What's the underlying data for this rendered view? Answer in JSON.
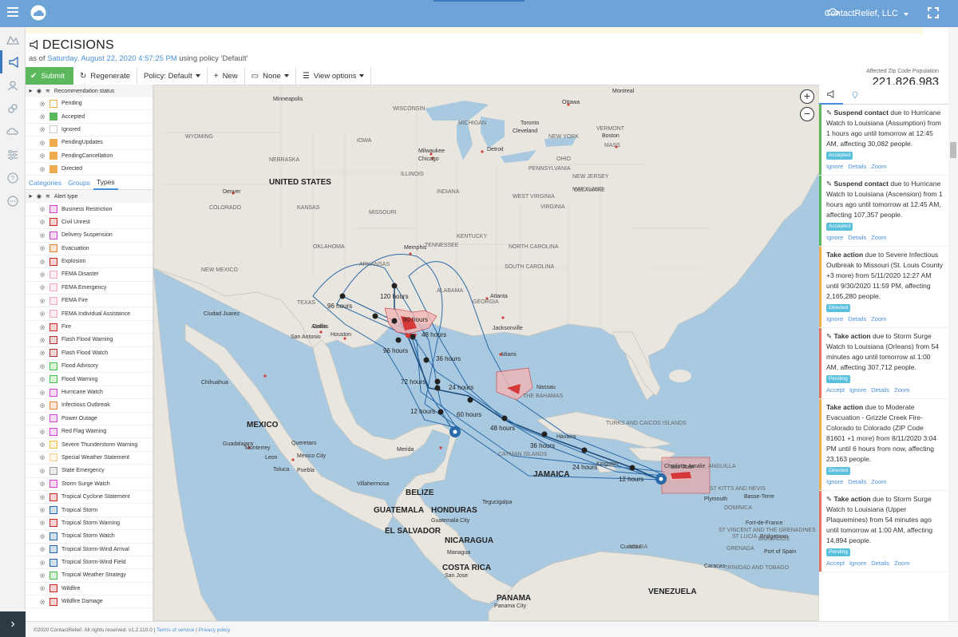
{
  "topbar": {
    "org": "ContactRelief, LLC"
  },
  "header": {
    "title": "DECISIONS",
    "as_of_prefix": "as of",
    "as_of_date": "Saturday, August 22, 2020 4:57:25 PM",
    "as_of_suffix": "using policy 'Default'",
    "affected_label": "Affected Zip Code Population",
    "affected_value": "221,826,983"
  },
  "toolbar": {
    "submit": "Submit",
    "regenerate": "Regenerate",
    "policy": "Policy: Default",
    "new": "New",
    "none": "None",
    "view_options": "View options"
  },
  "sidebar": {
    "rec_header": "Recommendation status",
    "statuses": [
      {
        "label": "Pending",
        "color": "#f0ad4e"
      },
      {
        "label": "Accepted",
        "color": "#5cb85c"
      },
      {
        "label": "Ignored",
        "color": "#cccccc"
      },
      {
        "label": "PendingUpdates",
        "color": "#f0ad4e"
      },
      {
        "label": "PendingCancellation",
        "color": "#f0ad4e"
      },
      {
        "label": "Directed",
        "color": "#f0ad4e"
      }
    ],
    "tabs": [
      "Categories",
      "Groups",
      "Types"
    ],
    "alert_header": "Alert type",
    "alert_types": [
      {
        "label": "Business Restriction",
        "color": "#cc44cc"
      },
      {
        "label": "Civil Unrest",
        "color": "#cc2222"
      },
      {
        "label": "Delivery Suspension",
        "color": "#cc44cc"
      },
      {
        "label": "Evacuation",
        "color": "#e08030"
      },
      {
        "label": "Explosion",
        "color": "#cc2222"
      },
      {
        "label": "FEMA Disaster",
        "color": "#f4a6c0"
      },
      {
        "label": "FEMA Emergency",
        "color": "#f4a6c0"
      },
      {
        "label": "FEMA Fire",
        "color": "#f4a6c0"
      },
      {
        "label": "FEMA Individual Assistance",
        "color": "#f4a6c0"
      },
      {
        "label": "Fire",
        "color": "#cc2222"
      },
      {
        "label": "Flash Flood Warning",
        "color": "#aa3333"
      },
      {
        "label": "Flash Flood Watch",
        "color": "#aa3333"
      },
      {
        "label": "Flood Advisory",
        "color": "#44bb44"
      },
      {
        "label": "Flood Warning",
        "color": "#44bb44"
      },
      {
        "label": "Hurricane Watch",
        "color": "#cc44cc"
      },
      {
        "label": "Infectious Outbreak",
        "color": "#e08030"
      },
      {
        "label": "Power Outage",
        "color": "#cc44cc"
      },
      {
        "label": "Red Flag Warning",
        "color": "#cc44cc"
      },
      {
        "label": "Severe Thunderstorm Warning",
        "color": "#f0c040"
      },
      {
        "label": "Special Weather Statement",
        "color": "#f4d090"
      },
      {
        "label": "State Emergency",
        "color": "#999999"
      },
      {
        "label": "Storm Surge Watch",
        "color": "#cc44cc"
      },
      {
        "label": "Tropical Cyclone Statement",
        "color": "#cc2222"
      },
      {
        "label": "Tropical Storm",
        "color": "#2266aa"
      },
      {
        "label": "Tropical Storm Warning",
        "color": "#cc2222"
      },
      {
        "label": "Tropical Storm Watch",
        "color": "#2266aa"
      },
      {
        "label": "Tropical Storm-Wind Arrival",
        "color": "#2266aa"
      },
      {
        "label": "Tropical Storm-Wind Field",
        "color": "#2266aa"
      },
      {
        "label": "Tropical Weather Strategy",
        "color": "#44bb44"
      },
      {
        "label": "Wildfire",
        "color": "#cc2222"
      },
      {
        "label": "Wildfire Damage",
        "color": "#cc2222"
      }
    ]
  },
  "map": {
    "countries": [
      "UNITED STATES",
      "MEXICO",
      "BELIZE",
      "GUATEMALA",
      "HONDURAS",
      "EL SALVADOR",
      "NICARAGUA",
      "COSTA RICA",
      "PANAMA",
      "VENEZUELA",
      "JAMAICA"
    ],
    "states": [
      "WISCONSIN",
      "MICHIGAN",
      "IOWA",
      "NEBRASKA",
      "ILLINOIS",
      "INDIANA",
      "OHIO",
      "PENNSYLVANIA",
      "NEW YORK",
      "VERMONT",
      "MASS",
      "NEW JERSEY",
      "MARYLAND",
      "WEST VIRGINIA",
      "VIRGINIA",
      "KANSAS",
      "MISSOURI",
      "KENTUCKY",
      "TENNESSEE",
      "NORTH CAROLINA",
      "SOUTH CAROLINA",
      "ARKANSAS",
      "OKLAHOMA",
      "NEW MEXICO",
      "TEXAS",
      "ALABAMA",
      "GEORGIA",
      "WYOMING",
      "COLORADO",
      "DELAWARE"
    ],
    "cities": [
      "Minneapolis",
      "Ottawa",
      "Montreal",
      "Toronto",
      "Milwaukee",
      "Detroit",
      "Chicago",
      "Cleveland",
      "Boston",
      "Denver",
      "Memphis",
      "Atlanta",
      "Dallas",
      "Houston",
      "Austin",
      "San Antonio",
      "Jacksonville",
      "Miami",
      "Nassau",
      "Monterrey",
      "Chihuahua",
      "Ciudad Juarez",
      "Mexico City",
      "Guadalajara",
      "Havana",
      "Kingston",
      "San Juan",
      "Caracas",
      "Managua",
      "San Jose",
      "Panama City",
      "Merida",
      "Guatemala City",
      "Tegucigalpa",
      "Puebla",
      "Queretaro",
      "Leon",
      "Toluca",
      "Villahermosa",
      "Curacao",
      "Charlotte Amalie",
      "Plymouth",
      "Basse-Terre",
      "Bridgetown",
      "Port of Spain",
      "Fort-de-France"
    ],
    "islands": [
      "THE BAHAMAS",
      "TURKS AND CAICOS ISLANDS",
      "CAYMAN ISLANDS",
      "ANGUILLA",
      "ST KITTS AND NEVIS",
      "DOMINICA",
      "ST VINCENT AND THE GRENADINES",
      "GRENADA",
      "TRINIDAD AND TOBAGO",
      "ARUBA",
      "ST LUCIA",
      "BARBADOS"
    ],
    "forecast_labels": [
      "120 hours",
      "96 hours",
      "60 hours",
      "48 hours",
      "96 hours",
      "36 hours",
      "72 hours",
      "24 hours",
      "12 hours",
      "60 hours",
      "48 hours",
      "36 hours",
      "24 hours",
      "12 hours"
    ]
  },
  "decisions": [
    {
      "action": "Suspend contact",
      "text": "due to Hurricane Watch to Louisiana (Assumption) from 1 hours ago until tomorrow at 12:45 AM, affecting 30,082 people.",
      "status": "Accepted",
      "status_color": "#5bc0de",
      "bar": "#5cb85c",
      "links": [
        "Ignore",
        "Details",
        "Zoom"
      ]
    },
    {
      "action": "Suspend contact",
      "text": "due to Hurricane Watch to Louisiana (Ascension) from 1 hours ago until tomorrow at 12:45 AM, affecting 107,357 people.",
      "status": "Accepted",
      "status_color": "#5bc0de",
      "bar": "#5cb85c",
      "links": [
        "Ignore",
        "Details",
        "Zoom"
      ]
    },
    {
      "action": "Take action",
      "text": "due to Severe Infectious Outbreak to Missouri (St. Louis County +3 more) from 5/11/2020 12:27 AM until 9/30/2020 11:59 PM, affecting 2,165,280 people.",
      "status": "Directed",
      "status_color": "#5bc0de",
      "bar": "#f0ad4e",
      "links": [
        "Ignore",
        "Details",
        "Zoom"
      ]
    },
    {
      "action": "Take action",
      "text": "due to Storm Surge Watch to Louisiana (Orleans) from 54 minutes ago until tomorrow at 1:00 AM, affecting 307,712 people.",
      "status": "Pending",
      "status_color": "#5bc0de",
      "bar": "#e8735a",
      "links": [
        "Accept",
        "Ignore",
        "Details",
        "Zoom"
      ]
    },
    {
      "action": "Take action",
      "text": "due to Moderate Evacuation - Grizzle Creek Fire- Colorado to Colorado (ZIP Code 81601 +1 more) from 8/11/2020 3:04 PM until 6 hours from now, affecting 23,163 people.",
      "status": "Directed",
      "status_color": "#5bc0de",
      "bar": "#f0ad4e",
      "links": [
        "Ignore",
        "Details",
        "Zoom"
      ]
    },
    {
      "action": "Take action",
      "text": "due to Storm Surge Watch to Louisiana (Upper Plaquemines) from 54 minutes ago until tomorrow at 1:00 AM, affecting 14,894 people.",
      "status": "Pending",
      "status_color": "#5bc0de",
      "bar": "#e8735a",
      "links": [
        "Accept",
        "Ignore",
        "Details",
        "Zoom"
      ]
    }
  ],
  "footer": {
    "copy": "©2020 ContactRelief. All rights reserved. v1.2.110.0 |",
    "terms": "Terms of service",
    "sep": "|",
    "privacy": "Privacy policy"
  }
}
